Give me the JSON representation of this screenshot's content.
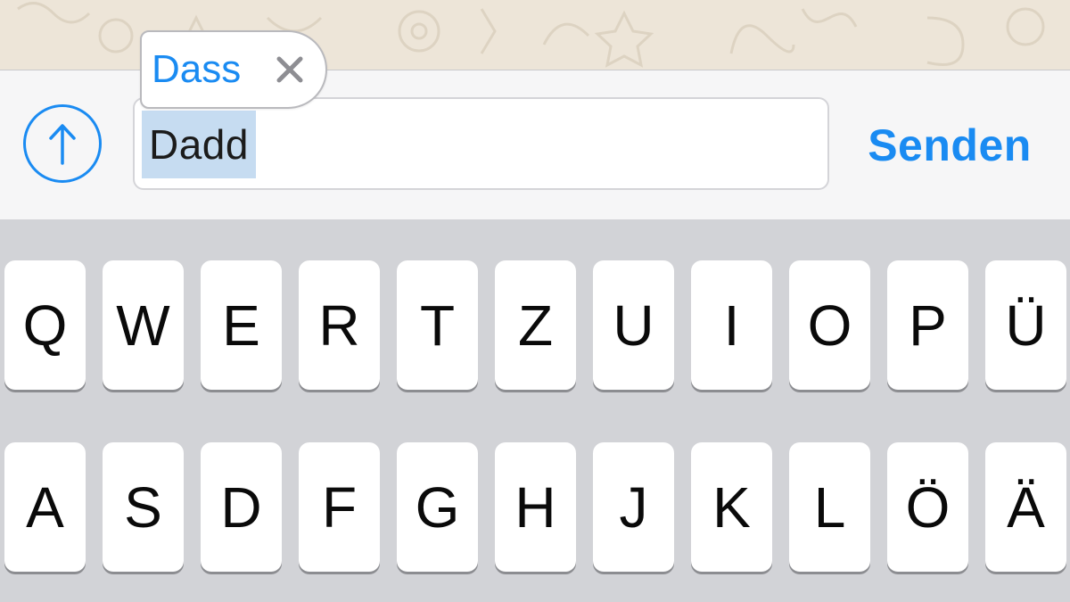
{
  "input": {
    "typed_text": "Dadd",
    "send_label": "Senden"
  },
  "autocorrect": {
    "suggestion": "Dass",
    "dismiss_icon": "close-icon"
  },
  "attach_icon": "arrow-up-circle-icon",
  "keyboard": {
    "row1": [
      "Q",
      "W",
      "E",
      "R",
      "T",
      "Z",
      "U",
      "I",
      "O",
      "P",
      "Ü"
    ],
    "row2": [
      "A",
      "S",
      "D",
      "F",
      "G",
      "H",
      "J",
      "K",
      "L",
      "Ö",
      "Ä"
    ]
  },
  "colors": {
    "accent": "#1a8bf2",
    "selection": "#c6dcf1",
    "keyboard_bg": "#d2d3d7",
    "wallpaper": "#ede5d8"
  }
}
